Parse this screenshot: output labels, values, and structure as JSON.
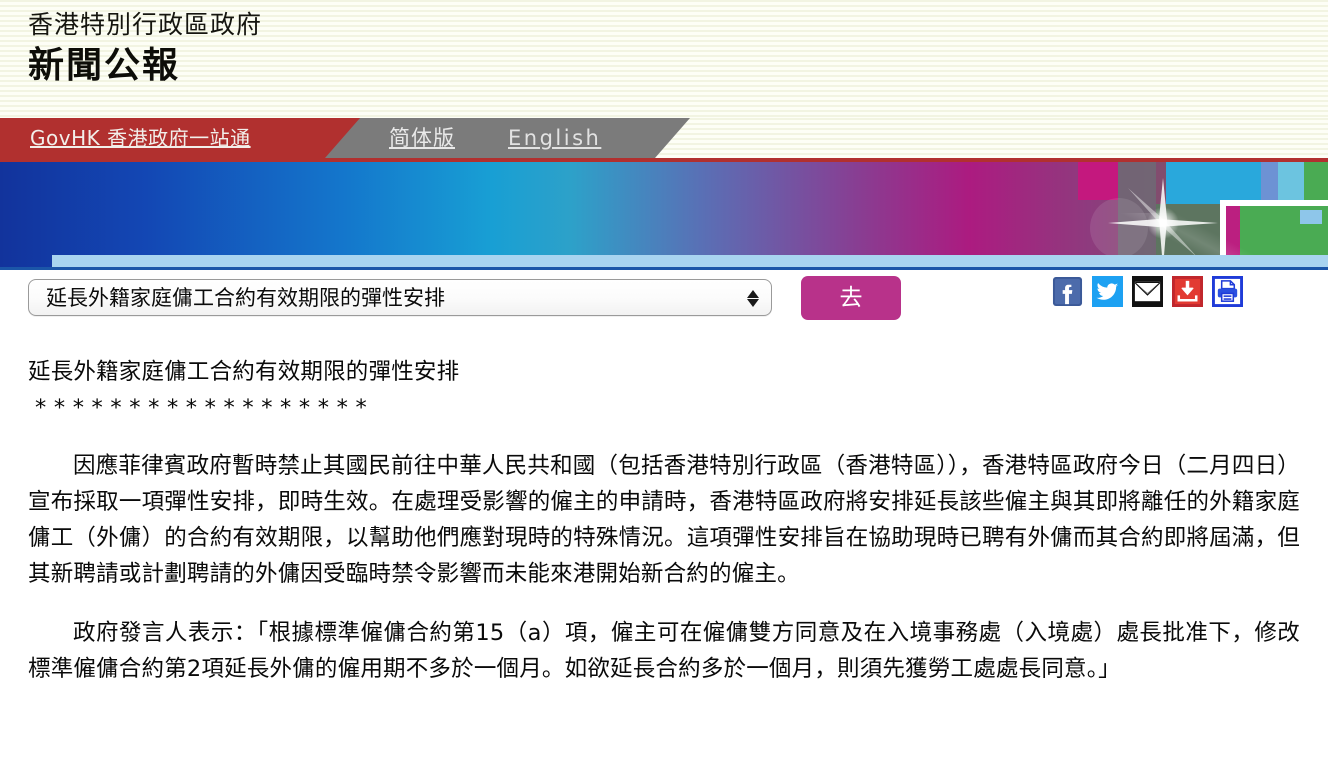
{
  "masthead": {
    "kicker": "香港特別行政區政府",
    "title": "新聞公報"
  },
  "govnav": {
    "govhk_label": "GovHK 香港政府一站通",
    "simplified_label": "简体版",
    "english_label": "English",
    "red_color": "#b1302f",
    "gray_color": "#7b7b7b"
  },
  "banner": {
    "accent_top_color": "#b1302f",
    "strip_color": "#a8d4f0",
    "gradient_start": "#12339c",
    "gradient_mid": "#189fd4",
    "gradient_end": "#ac1b80"
  },
  "controls": {
    "select_value": "延長外籍家庭傭工合約有效期限的彈性安排",
    "go_label": "去",
    "go_color": "#b8328a",
    "social": [
      {
        "name": "facebook-icon",
        "title": "Facebook",
        "color": "#3b5998"
      },
      {
        "name": "twitter-icon",
        "title": "Twitter",
        "color": "#1da1f2"
      },
      {
        "name": "email-icon",
        "title": "Email",
        "color": "#111111"
      },
      {
        "name": "download-icon",
        "title": "Download",
        "color": "#c0272d"
      },
      {
        "name": "print-icon",
        "title": "Print",
        "color": "#1f3bd8"
      }
    ]
  },
  "article": {
    "headline": "延長外籍家庭傭工合約有效期限的彈性安排",
    "stars": "******************",
    "paragraphs": [
      "因應菲律賓政府暫時禁止其國民前往中華人民共和國（包括香港特別行政區（香港特區）），香港特區政府今日（二月四日）宣布採取一項彈性安排，即時生效。在處理受影響的僱主的申請時，香港特區政府將安排延長該些僱主與其即將離任的外籍家庭傭工（外傭）的合約有效期限，以幫助他們應對現時的特殊情況。這項彈性安排旨在協助現時已聘有外傭而其合約即將屆滿，但其新聘請或計劃聘請的外傭因受臨時禁令影響而未能來港開始新合約的僱主。",
      "政府發言人表示：「根據標準僱傭合約第15（a）項，僱主可在僱傭雙方同意及在入境事務處（入境處）處長批准下，修改標準僱傭合約第2項延長外傭的僱用期不多於一個月。如欲延長合約多於一個月，則須先獲勞工處處長同意。」"
    ]
  }
}
